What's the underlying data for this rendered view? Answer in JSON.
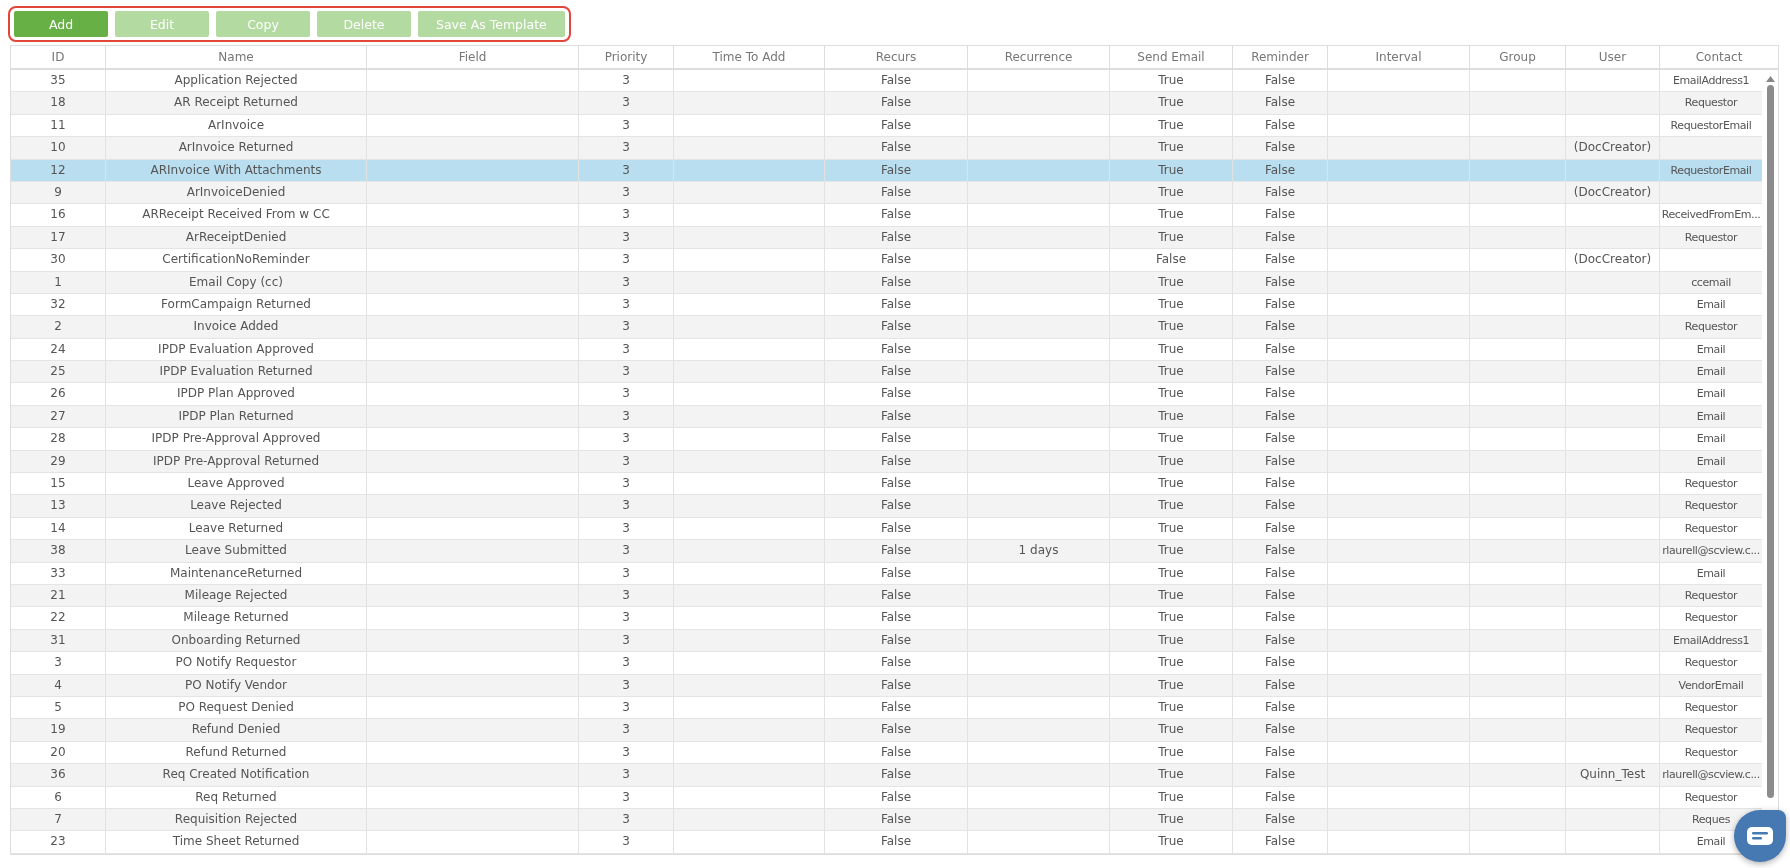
{
  "toolbar": {
    "buttons": [
      {
        "label": "Add",
        "disabled": false
      },
      {
        "label": "Edit",
        "disabled": true
      },
      {
        "label": "Copy",
        "disabled": true
      },
      {
        "label": "Delete",
        "disabled": true
      },
      {
        "label": "Save As Template",
        "disabled": true
      }
    ]
  },
  "table": {
    "columns": [
      "ID",
      "Name",
      "Field",
      "Priority",
      "Time To Add",
      "Recurs",
      "Recurrence",
      "Send Email",
      "Reminder",
      "Interval",
      "Group",
      "User",
      "Contact"
    ],
    "rows": [
      {
        "id": "35",
        "name": "Application Rejected",
        "priority": "3",
        "recurs": "False",
        "send_email": "True",
        "reminder": "False",
        "contact": "EmailAddress1",
        "selected": false
      },
      {
        "id": "18",
        "name": "AR Receipt Returned",
        "priority": "3",
        "recurs": "False",
        "send_email": "True",
        "reminder": "False",
        "contact": "Requestor",
        "selected": false
      },
      {
        "id": "11",
        "name": "ArInvoice",
        "priority": "3",
        "recurs": "False",
        "send_email": "True",
        "reminder": "False",
        "contact": "RequestorEmail",
        "selected": false
      },
      {
        "id": "10",
        "name": "ArInvoice Returned",
        "priority": "3",
        "recurs": "False",
        "send_email": "True",
        "reminder": "False",
        "user": "(DocCreator)",
        "selected": false
      },
      {
        "id": "12",
        "name": "ARInvoice With Attachments",
        "priority": "3",
        "recurs": "False",
        "send_email": "True",
        "reminder": "False",
        "contact": "RequestorEmail",
        "selected": true
      },
      {
        "id": "9",
        "name": "ArInvoiceDenied",
        "priority": "3",
        "recurs": "False",
        "send_email": "True",
        "reminder": "False",
        "user": "(DocCreator)",
        "selected": false
      },
      {
        "id": "16",
        "name": "ARReceipt Received From w CC",
        "priority": "3",
        "recurs": "False",
        "send_email": "True",
        "reminder": "False",
        "contact": "ReceivedFromEm...",
        "selected": false
      },
      {
        "id": "17",
        "name": "ArReceiptDenied",
        "priority": "3",
        "recurs": "False",
        "send_email": "True",
        "reminder": "False",
        "contact": "Requestor",
        "selected": false
      },
      {
        "id": "30",
        "name": "CertificationNoReminder",
        "priority": "3",
        "recurs": "False",
        "send_email": "False",
        "reminder": "False",
        "user": "(DocCreator)",
        "selected": false
      },
      {
        "id": "1",
        "name": "Email Copy (cc)",
        "priority": "3",
        "recurs": "False",
        "send_email": "True",
        "reminder": "False",
        "contact": "ccemail",
        "selected": false
      },
      {
        "id": "32",
        "name": "FormCampaign Returned",
        "priority": "3",
        "recurs": "False",
        "send_email": "True",
        "reminder": "False",
        "contact": "Email",
        "selected": false
      },
      {
        "id": "2",
        "name": "Invoice Added",
        "priority": "3",
        "recurs": "False",
        "send_email": "True",
        "reminder": "False",
        "contact": "Requestor",
        "selected": false
      },
      {
        "id": "24",
        "name": "IPDP Evaluation Approved",
        "priority": "3",
        "recurs": "False",
        "send_email": "True",
        "reminder": "False",
        "contact": "Email",
        "selected": false
      },
      {
        "id": "25",
        "name": "IPDP Evaluation Returned",
        "priority": "3",
        "recurs": "False",
        "send_email": "True",
        "reminder": "False",
        "contact": "Email",
        "selected": false
      },
      {
        "id": "26",
        "name": "IPDP Plan Approved",
        "priority": "3",
        "recurs": "False",
        "send_email": "True",
        "reminder": "False",
        "contact": "Email",
        "selected": false
      },
      {
        "id": "27",
        "name": "IPDP Plan Returned",
        "priority": "3",
        "recurs": "False",
        "send_email": "True",
        "reminder": "False",
        "contact": "Email",
        "selected": false
      },
      {
        "id": "28",
        "name": "IPDP Pre-Approval Approved",
        "priority": "3",
        "recurs": "False",
        "send_email": "True",
        "reminder": "False",
        "contact": "Email",
        "selected": false
      },
      {
        "id": "29",
        "name": "IPDP Pre-Approval Returned",
        "priority": "3",
        "recurs": "False",
        "send_email": "True",
        "reminder": "False",
        "contact": "Email",
        "selected": false
      },
      {
        "id": "15",
        "name": "Leave Approved",
        "priority": "3",
        "recurs": "False",
        "send_email": "True",
        "reminder": "False",
        "contact": "Requestor",
        "selected": false
      },
      {
        "id": "13",
        "name": "Leave Rejected",
        "priority": "3",
        "recurs": "False",
        "send_email": "True",
        "reminder": "False",
        "contact": "Requestor",
        "selected": false
      },
      {
        "id": "14",
        "name": "Leave Returned",
        "priority": "3",
        "recurs": "False",
        "send_email": "True",
        "reminder": "False",
        "contact": "Requestor",
        "selected": false
      },
      {
        "id": "38",
        "name": "Leave Submitted",
        "priority": "3",
        "recurs": "False",
        "recurrence": "1 days",
        "send_email": "True",
        "reminder": "False",
        "contact": "rlaurell@scview.c...",
        "selected": false
      },
      {
        "id": "33",
        "name": "MaintenanceReturned",
        "priority": "3",
        "recurs": "False",
        "send_email": "True",
        "reminder": "False",
        "contact": "Email",
        "selected": false
      },
      {
        "id": "21",
        "name": "Mileage Rejected",
        "priority": "3",
        "recurs": "False",
        "send_email": "True",
        "reminder": "False",
        "contact": "Requestor",
        "selected": false
      },
      {
        "id": "22",
        "name": "Mileage Returned",
        "priority": "3",
        "recurs": "False",
        "send_email": "True",
        "reminder": "False",
        "contact": "Requestor",
        "selected": false
      },
      {
        "id": "31",
        "name": "Onboarding Returned",
        "priority": "3",
        "recurs": "False",
        "send_email": "True",
        "reminder": "False",
        "contact": "EmailAddress1",
        "selected": false
      },
      {
        "id": "3",
        "name": "PO Notify Requestor",
        "priority": "3",
        "recurs": "False",
        "send_email": "True",
        "reminder": "False",
        "contact": "Requestor",
        "selected": false
      },
      {
        "id": "4",
        "name": "PO Notify Vendor",
        "priority": "3",
        "recurs": "False",
        "send_email": "True",
        "reminder": "False",
        "contact": "VendorEmail",
        "selected": false
      },
      {
        "id": "5",
        "name": "PO Request Denied",
        "priority": "3",
        "recurs": "False",
        "send_email": "True",
        "reminder": "False",
        "contact": "Requestor",
        "selected": false
      },
      {
        "id": "19",
        "name": "Refund Denied",
        "priority": "3",
        "recurs": "False",
        "send_email": "True",
        "reminder": "False",
        "contact": "Requestor",
        "selected": false
      },
      {
        "id": "20",
        "name": "Refund Returned",
        "priority": "3",
        "recurs": "False",
        "send_email": "True",
        "reminder": "False",
        "contact": "Requestor",
        "selected": false
      },
      {
        "id": "36",
        "name": "Req Created Notification",
        "priority": "3",
        "recurs": "False",
        "send_email": "True",
        "reminder": "False",
        "user": "Quinn_Test",
        "contact": "rlaurell@scview.c...",
        "selected": false
      },
      {
        "id": "6",
        "name": "Req Returned",
        "priority": "3",
        "recurs": "False",
        "send_email": "True",
        "reminder": "False",
        "contact": "Requestor",
        "selected": false
      },
      {
        "id": "7",
        "name": "Requisition Rejected",
        "priority": "3",
        "recurs": "False",
        "send_email": "True",
        "reminder": "False",
        "contact": "Reques",
        "selected": false
      },
      {
        "id": "23",
        "name": "Time Sheet Returned",
        "priority": "3",
        "recurs": "False",
        "send_email": "True",
        "reminder": "False",
        "contact": "Email",
        "selected": false
      }
    ]
  }
}
